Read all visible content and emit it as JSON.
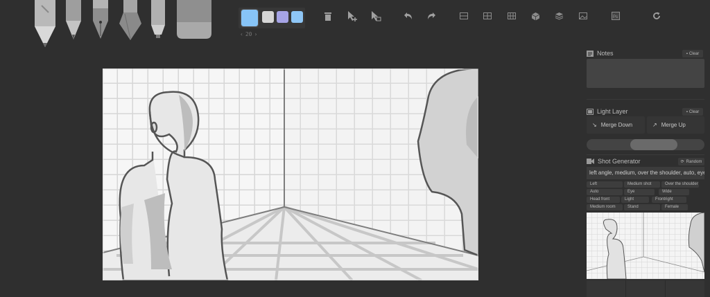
{
  "brush_tools": [
    {
      "name": "pencil"
    },
    {
      "name": "pen"
    },
    {
      "name": "fountain-pen"
    },
    {
      "name": "brush"
    },
    {
      "name": "marker"
    },
    {
      "name": "eraser"
    }
  ],
  "palette": {
    "colors": [
      "#87c4f7",
      "#d6d6d6",
      "#a6a4e6",
      "#8ec6f6"
    ],
    "brush_size": "20"
  },
  "toolbar": {
    "icons": [
      "trash-icon",
      "add-pointer-icon",
      "select-pointer-icon",
      "undo-icon",
      "redo-icon",
      "grid-2-icon",
      "grid-3-icon",
      "grid-4-icon",
      "cube-icon",
      "layers-icon",
      "image-icon",
      "photoshop-icon",
      "refresh-icon"
    ]
  },
  "notes": {
    "title": "Notes",
    "clear_label": "Clear"
  },
  "light_layer": {
    "title": "Light Layer",
    "clear_label": "Clear",
    "merge_down_label": "Merge Down",
    "merge_up_label": "Merge Up",
    "opacity": 0.62
  },
  "shot_generator": {
    "title": "Shot Generator",
    "random_label": "Random",
    "description": "left angle, medium, over the shoulder, auto, eye",
    "tags": [
      [
        "Left",
        "Medium shot",
        "Over the shoulder"
      ],
      [
        "Auto",
        "Eye",
        "Wide"
      ],
      [
        "Head front",
        "Light",
        "Frontright"
      ],
      [
        "Medium room",
        "Stand",
        "Female"
      ]
    ]
  }
}
